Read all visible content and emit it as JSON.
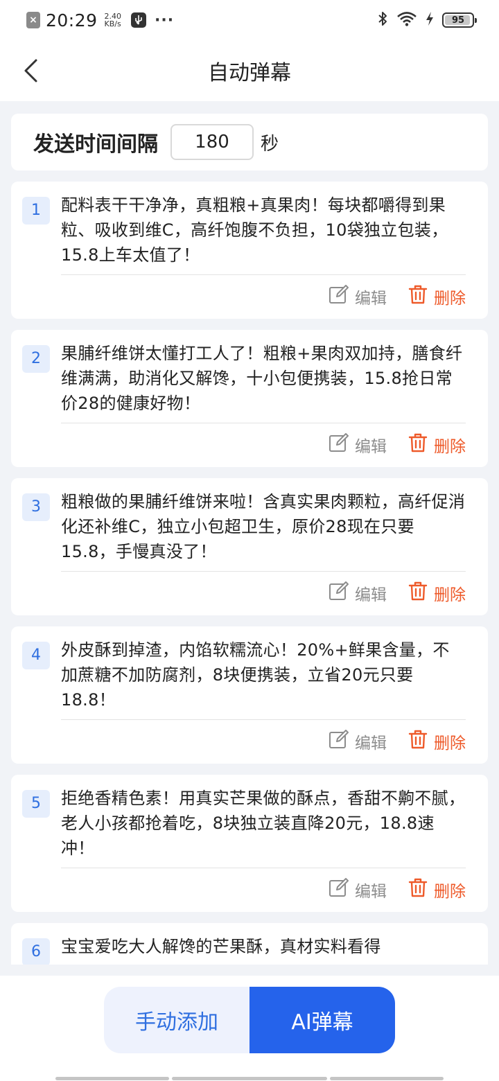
{
  "status_bar": {
    "time": "20:29",
    "speed_value": "2.40",
    "speed_unit": "KB/s",
    "battery": "95",
    "battery_level": 0.95
  },
  "header": {
    "title": "自动弹幕"
  },
  "interval": {
    "label": "发送时间间隔",
    "value": "180",
    "unit": "秒"
  },
  "actions": {
    "edit_label": "编辑",
    "delete_label": "删除"
  },
  "danmaku": [
    {
      "num": "1",
      "text": "配料表干干净净，真粗粮+真果肉！每块都嚼得到果粒、吸收到维C，高纤饱腹不负担，10袋独立包装，15.8上车太值了！"
    },
    {
      "num": "2",
      "text": "果脯纤维饼太懂打工人了！粗粮+果肉双加持，膳食纤维满满，助消化又解馋，十小包便携装，15.8抢日常价28的健康好物！"
    },
    {
      "num": "3",
      "text": "粗粮做的果脯纤维饼来啦！含真实果肉颗粒，高纤促消化还补维C，独立小包超卫生，原价28现在只要15.8，手慢真没了！"
    },
    {
      "num": "4",
      "text": "外皮酥到掉渣，内馅软糯流心！20%+鲜果含量，不加蔗糖不加防腐剂，8块便携装，立省20元只要18.8！"
    },
    {
      "num": "5",
      "text": "拒绝香精色素！用真实芒果做的酥点，香甜不齁不腻，老人小孩都抢着吃，8块独立装直降20元，18.8速冲！"
    },
    {
      "num": "6",
      "text": "宝宝爱吃大人解馋的芒果酥，真材实料看得"
    }
  ],
  "bottom": {
    "manual_label": "手动添加",
    "ai_label": "AI弹幕"
  },
  "colors": {
    "accent": "#2563eb",
    "delete": "#ee5a2a",
    "badge_bg": "#e6eefc"
  }
}
